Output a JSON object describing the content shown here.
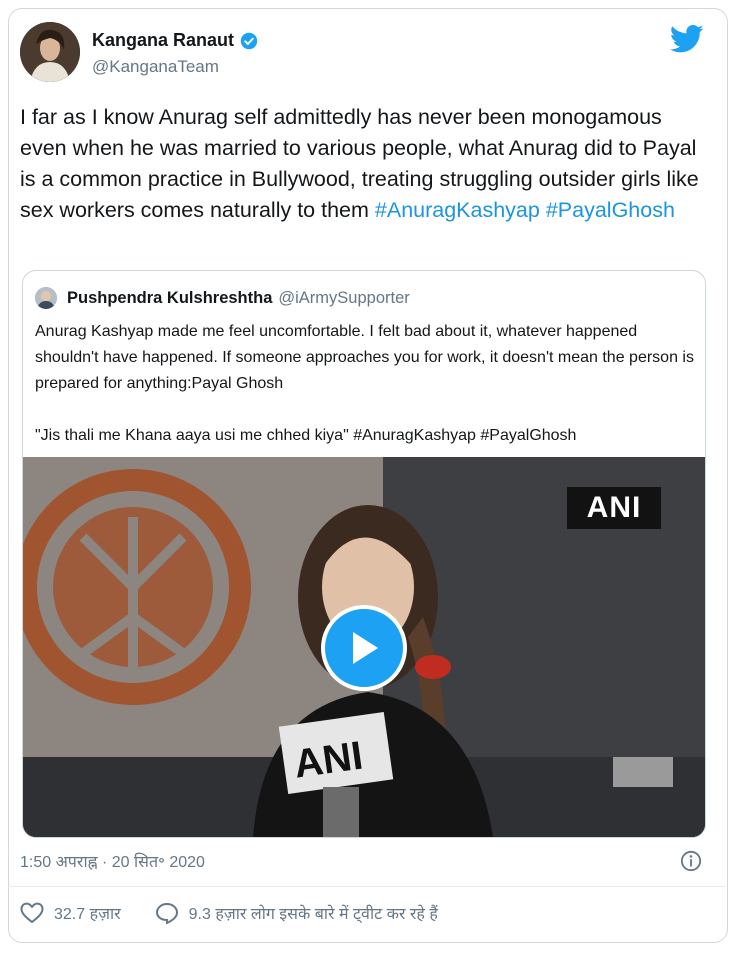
{
  "author": {
    "name": "Kangana Ranaut",
    "handle": "@KanganaTeam"
  },
  "tweet": {
    "text_plain": "I far as I know Anurag self admittedly has never been monogamous even when he was married to various people, what Anurag did to Payal is a common practice in Bullywood, treating struggling outsider girls like sex workers comes naturally to them ",
    "hashtag_1": "#AnuragKashyap",
    "hashtag_2": "#PayalGhosh"
  },
  "quoted": {
    "name": "Pushpendra Kulshreshtha",
    "handle": "@iArmySupporter",
    "line_1": "Anurag Kashyap made me feel uncomfortable. I felt bad about it, whatever happened shouldn't have happened. If someone approaches you for work, it doesn't mean the person is prepared for anything:Payal Ghosh",
    "line_2": "\"Jis thali me Khana aaya usi me chhed kiya\" #AnuragKashyap #PayalGhosh",
    "video_watermark": "ANI",
    "mic_label": "ANI"
  },
  "timestamp": "1:50 अपराह्न · 20 सित॰ 2020",
  "likes": "32.7 हज़ार",
  "conversation": "9.3 हज़ार लोग इसके बारे में ट्वीट कर रहे हैं",
  "icons": [
    "verified-icon",
    "twitter-bird-icon",
    "play-icon",
    "info-icon",
    "heart-icon",
    "comment-icon"
  ],
  "colors": {
    "accent": "#1da1f2",
    "hashtag": "#1b95e0",
    "secondary_text": "#657786"
  }
}
